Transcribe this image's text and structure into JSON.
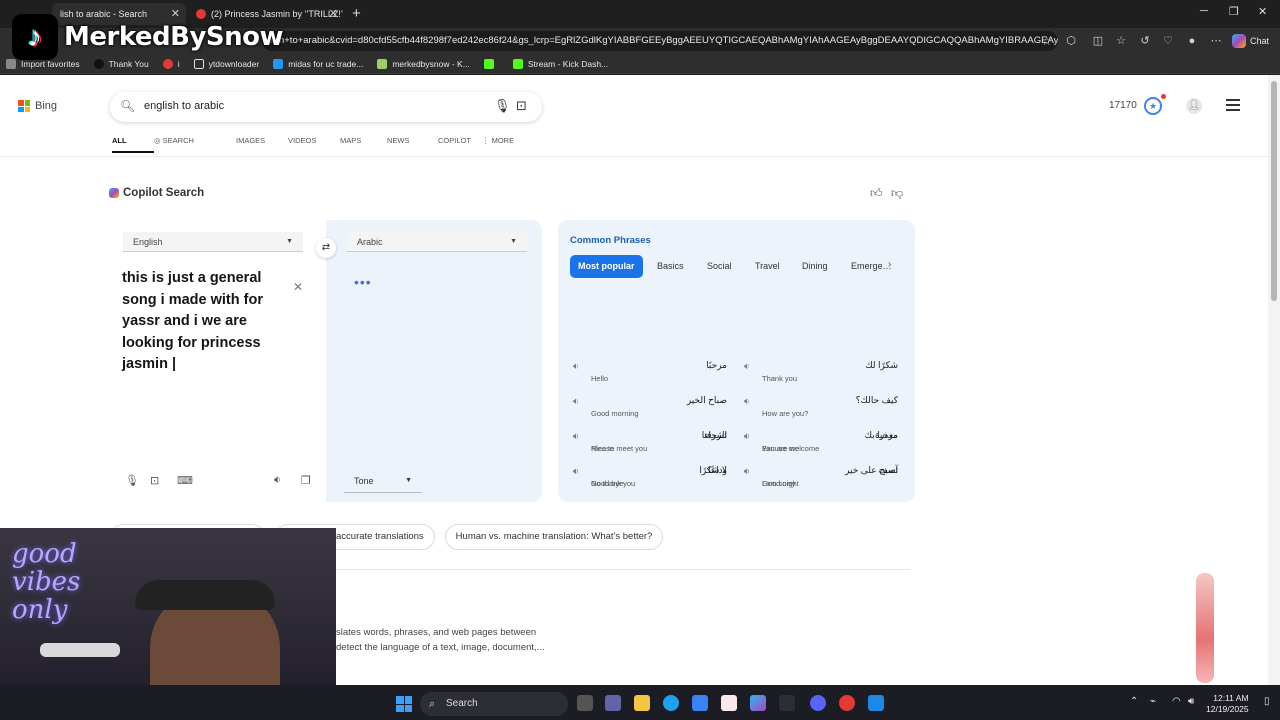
{
  "browser": {
    "tabs": [
      {
        "title": "lish to arabic - Search"
      },
      {
        "title": "(2) Princess Jasmin by ’’TRILLZ!’"
      }
    ],
    "url": "lish+to+arabic&cvid=d80cfd55cfb44f8298f7ed242ec86f24&gs_lcrp=EgRlZGdlKgYIABBFGEEyBggAEEUYQTIGCAEQABhAMgYIAhAAGEAyBggDEAAYQDIGCAQQABhAMgYIBRAAGEAyBgg...",
    "copilot_label": "Chat",
    "bookmarks": [
      {
        "label": "Import favorites"
      },
      {
        "label": "Thank You"
      },
      {
        "label": "i"
      },
      {
        "label": "ytdownloader"
      },
      {
        "label": "midas for uc trade..."
      },
      {
        "label": "merkedbysnow - K..."
      },
      {
        "label": ""
      },
      {
        "label": "Stream - Kick Dash..."
      }
    ]
  },
  "bing": {
    "logo_text": "Bing",
    "search_query": "english to arabic",
    "rewards_points": "17170",
    "nav_tabs": [
      {
        "label": "ALL",
        "active": true
      },
      {
        "label": "SEARCH"
      },
      {
        "label": "IMAGES"
      },
      {
        "label": "VIDEOS"
      },
      {
        "label": "MAPS"
      },
      {
        "label": "NEWS"
      },
      {
        "label": "COPILOT"
      },
      {
        "label": "MORE"
      }
    ],
    "copilot_search_title": "Copilot Search"
  },
  "translator": {
    "source_language": "English",
    "target_language": "Arabic",
    "source_text": "this is just a general song i made with for yassr and i we are looking for princess jasmin",
    "loading_indicator": "•••",
    "tone_label": "Tone"
  },
  "phrases": {
    "title": "Common Phrases",
    "categories": [
      {
        "label": "Most popular",
        "active": true
      },
      {
        "label": "Basics"
      },
      {
        "label": "Social"
      },
      {
        "label": "Travel"
      },
      {
        "label": "Dining"
      },
      {
        "label": "Emerge…"
      }
    ],
    "items": [
      {
        "arabic": "مرحبًا",
        "english": "Hello"
      },
      {
        "arabic": "شكرًا لك",
        "english": "Thank you"
      },
      {
        "arabic": "صباح الخير",
        "english": "Good morning"
      },
      {
        "arabic": "كيف حالك؟",
        "english": "How are you?"
      },
      {
        "arabic": "تشرفنا",
        "english": "Nice to meet you"
      },
      {
        "arabic": "مرحبا بك",
        "english": "You are welcome"
      },
      {
        "arabic": "وداعًا",
        "english": "Good bye"
      },
      {
        "arabic": "تصبح على خير",
        "english": "Good night"
      },
      {
        "arabic": "الرجاء",
        "english": "Please"
      },
      {
        "arabic": "معذرة",
        "english": "Excuse me"
      },
      {
        "arabic": "لا شكرًا",
        "english": "No thank you"
      },
      {
        "arabic": "آسف",
        "english": "I am sorry"
      }
    ]
  },
  "related": {
    "chips": [
      {
        "label": "accurate translations"
      },
      {
        "label": "Human vs. machine translation: What's better?"
      }
    ],
    "snippet_line1": "slates words, phrases, and web pages between",
    "snippet_line2": "detect the language of a text, image, document,..."
  },
  "overlay": {
    "tiktok_name": "MerkedBySnow",
    "neon_text_1": "good",
    "neon_text_2": "vibes",
    "neon_text_3": "only"
  },
  "taskbar": {
    "search_label": "Search",
    "time": "12:11 AM",
    "date": "12/19/2025"
  },
  "colors": {
    "accent": "#1a73e8",
    "phrases_bg": "#edf3fb",
    "taskbar": "#1c1c24"
  }
}
